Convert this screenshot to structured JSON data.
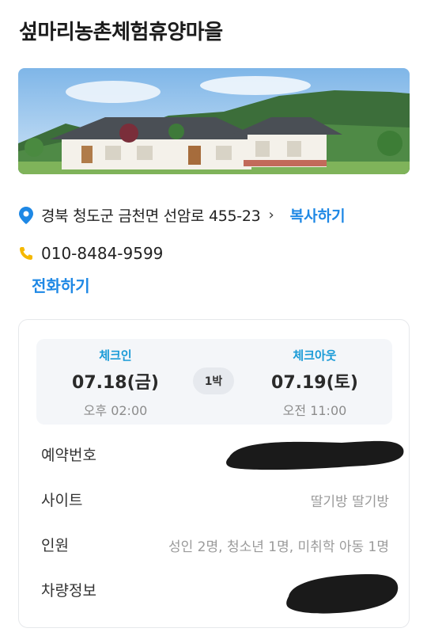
{
  "page": {
    "title": "섶마리농촌체험휴양마을"
  },
  "address": {
    "text": "경북 청도군 금천면 선암로 455-23",
    "chevron": "›",
    "copy_label": "복사하기"
  },
  "phone": {
    "number": "010-8484-9599",
    "call_label": "전화하기"
  },
  "stay": {
    "checkin": {
      "label": "체크인",
      "date": "07.18(금)",
      "time": "오후 02:00"
    },
    "nights": "1박",
    "checkout": {
      "label": "체크아웃",
      "date": "07.19(토)",
      "time": "오전 11:00"
    }
  },
  "details": {
    "reservation_label": "예약번호",
    "site_label": "사이트",
    "site_value": "딸기방 딸기방",
    "guests_label": "인원",
    "guests_value": "성인 2명, 청소년 1명, 미취학 아동 1명",
    "vehicle_label": "차량정보"
  },
  "colors": {
    "accent": "#1e88e5",
    "checkin_label": "#1a9bd7",
    "pin": "#1e88e5",
    "phone_icon": "#f5b800"
  },
  "icons": {
    "location": "location-pin-icon",
    "phone": "phone-icon"
  }
}
